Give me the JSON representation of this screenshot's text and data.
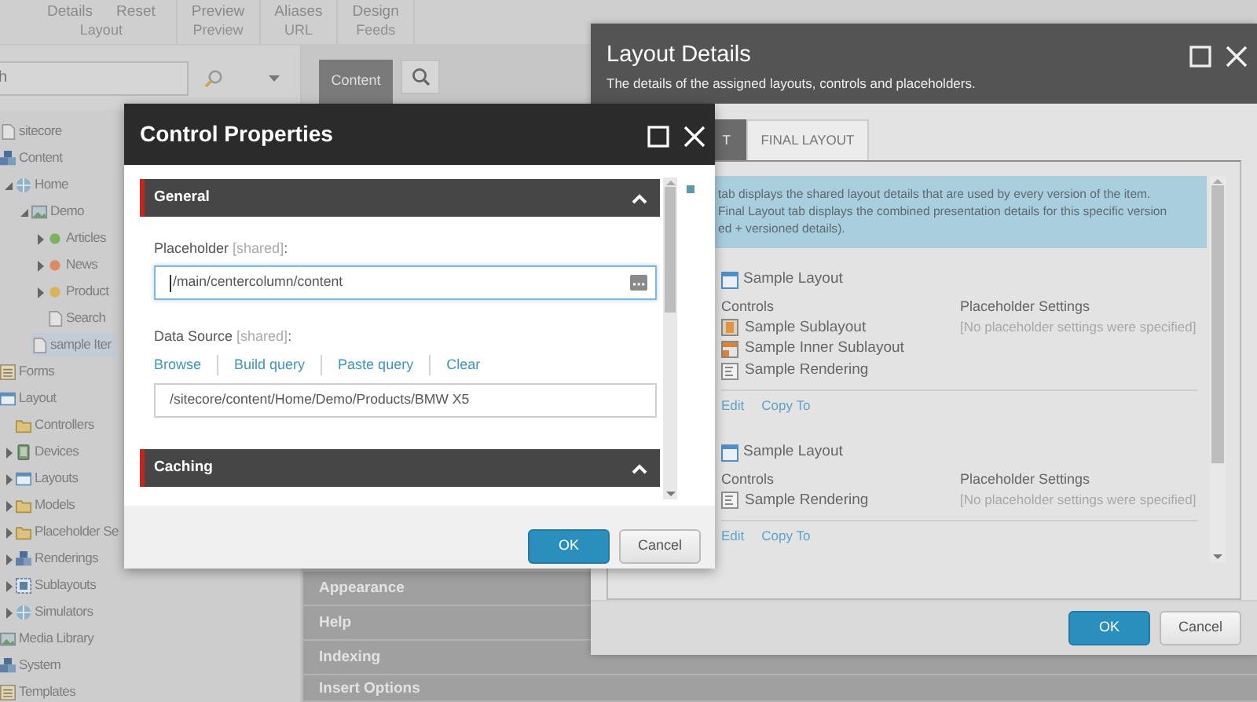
{
  "ribbon": {
    "groups": [
      {
        "buttons": [
          "Details",
          "Reset"
        ],
        "label": "Layout"
      },
      {
        "buttons": [
          "Preview"
        ],
        "label": "Preview"
      },
      {
        "buttons": [
          "Aliases"
        ],
        "label": "URL"
      },
      {
        "buttons": [
          "Design"
        ],
        "label": "Feeds"
      }
    ]
  },
  "tree_search": {
    "placeholder": "h"
  },
  "tree": [
    {
      "label": "sitecore",
      "kind": "page",
      "selected": false,
      "children": [
        {
          "label": "Content",
          "kind": "cubes",
          "selected": false,
          "children": [
            {
              "label": "Home",
              "kind": "globe",
              "expanded": true,
              "selected": false,
              "children": [
                {
                  "label": "Demo",
                  "kind": "image",
                  "expanded": true,
                  "selected": false,
                  "children": [
                    {
                      "label": "Articles",
                      "kind": "dot",
                      "color": "#7bb35e",
                      "expanded": false,
                      "selected": false
                    },
                    {
                      "label": "News",
                      "kind": "dot",
                      "color": "#dc8a62",
                      "expanded": false,
                      "selected": false
                    },
                    {
                      "label": "Product",
                      "kind": "dot",
                      "color": "#d9b45a",
                      "expanded": false,
                      "selected": false
                    },
                    {
                      "label": "Search",
                      "kind": "page",
                      "selected": false
                    }
                  ]
                },
                {
                  "label": "sample Iter",
                  "kind": "page",
                  "selected": true
                }
              ]
            }
          ]
        },
        {
          "label": "Forms",
          "kind": "list",
          "selected": false
        },
        {
          "label": "Layout",
          "kind": "window",
          "selected": false,
          "children": [
            {
              "label": "Controllers",
              "kind": "folder",
              "selected": false
            },
            {
              "label": "Devices",
              "kind": "device",
              "expanded": false,
              "selected": false
            },
            {
              "label": "Layouts",
              "kind": "window",
              "expanded": false,
              "selected": false
            },
            {
              "label": "Models",
              "kind": "folder",
              "expanded": false,
              "selected": false
            },
            {
              "label": "Placeholder Se",
              "kind": "folder",
              "expanded": false,
              "selected": false
            },
            {
              "label": "Renderings",
              "kind": "cubes",
              "expanded": false,
              "selected": false
            },
            {
              "label": "Sublayouts",
              "kind": "grid",
              "expanded": false,
              "selected": false
            },
            {
              "label": "Simulators",
              "kind": "globe",
              "expanded": false,
              "selected": false
            }
          ]
        },
        {
          "label": "Media Library",
          "kind": "image",
          "selected": false
        },
        {
          "label": "System",
          "kind": "cubes",
          "selected": false
        },
        {
          "label": "Templates",
          "kind": "list",
          "selected": false
        }
      ]
    }
  ],
  "editor": {
    "tabs": [
      {
        "label": "Content",
        "selected": true
      }
    ],
    "sections": [
      "Appearance",
      "Help",
      "Indexing",
      "Insert Options"
    ]
  },
  "layout_dialog": {
    "title": "Layout Details",
    "subtitle": "The details of the assigned layouts, controls and placeholders.",
    "tabs": [
      {
        "label": "T",
        "selected": true
      },
      {
        "label": "FINAL LAYOUT",
        "selected": false
      }
    ],
    "info_lines": [
      "tab displays the shared layout details that are used by every version of the item.",
      "Final Layout tab displays the combined presentation details for this specific version",
      "ed + versioned details)."
    ],
    "devices": [
      {
        "layout": "Sample Layout",
        "controls_heading": "Controls",
        "placeholders_heading": "Placeholder Settings",
        "controls": [
          {
            "name": "Sample Sublayout",
            "kind": "sublayout"
          },
          {
            "name": "Sample Inner Sublayout",
            "kind": "inner"
          },
          {
            "name": "Sample Rendering",
            "kind": "rendering"
          }
        ],
        "placeholders_note": "[No placeholder settings were specified]",
        "links": [
          "Edit",
          "Copy To"
        ]
      },
      {
        "layout": "Sample Layout",
        "controls_heading": "Controls",
        "placeholders_heading": "Placeholder Settings",
        "controls": [
          {
            "name": "Sample Rendering",
            "kind": "rendering"
          }
        ],
        "placeholders_note": "[No placeholder settings were specified]",
        "links": [
          "Edit",
          "Copy To"
        ]
      }
    ],
    "buttons": [
      {
        "label": "OK",
        "primary": true
      },
      {
        "label": "Cancel",
        "primary": false
      }
    ]
  },
  "control_dialog": {
    "title": "Control Properties",
    "sections": [
      {
        "title": "General",
        "expanded": true,
        "fields": [
          {
            "kind": "picker",
            "label": "Placeholder",
            "note": "[shared]",
            "suffix": ":",
            "value": "/main/centercolumn/content",
            "focused": true
          },
          {
            "kind": "text",
            "label": "Data Source",
            "note": "[shared]",
            "suffix": ":",
            "links": [
              "Browse",
              "Build query",
              "Paste query",
              "Clear"
            ],
            "value": "/sitecore/content/Home/Demo/Products/BMW X5",
            "focused": false
          }
        ]
      },
      {
        "title": "Caching",
        "expanded": true
      }
    ],
    "buttons": [
      {
        "label": "OK",
        "primary": true
      },
      {
        "label": "Cancel",
        "primary": false
      }
    ]
  }
}
